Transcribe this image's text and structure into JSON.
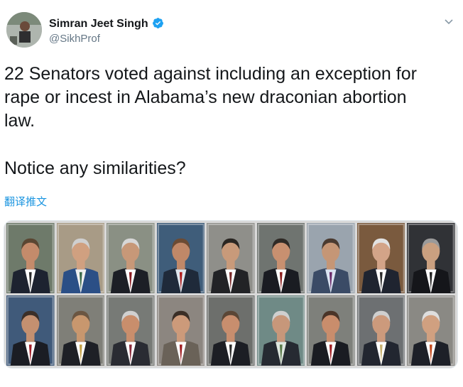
{
  "tweet": {
    "author_name": "Simran Jeet Singh",
    "author_handle": "@SikhProf",
    "text_line1": "22 Senators voted against including an exception for",
    "text_line2": "rape or incest in Alabama’s new draconian abortion",
    "text_line3": "law.",
    "text_question": "Notice any similarities?",
    "translate_label": "翻译推文"
  },
  "icons": {
    "verified": "verified-badge-icon",
    "menu": "chevron-down-icon"
  },
  "colors": {
    "text": "#14171a",
    "handle": "#657786",
    "link": "#1b95e0",
    "verified": "#1da1f2"
  },
  "media": {
    "rows": 2,
    "cols": 9,
    "photos": [
      {
        "bg": "#6e7a6a",
        "skin": "#c48b6b",
        "hair": "#5a4632",
        "suit": "#1d2330",
        "shirt": "#ffffff",
        "tie": "#2b2b2b"
      },
      {
        "bg": "#a89b86",
        "skin": "#d0a080",
        "hair": "#cfcfcf",
        "suit": "#2b4f86",
        "shirt": "#f0f0f0",
        "tie": "#3a6a4a"
      },
      {
        "bg": "#8a9084",
        "skin": "#c79878",
        "hair": "#d7d7d7",
        "suit": "#1c1f26",
        "shirt": "#ffffff",
        "tie": "#8a1c22"
      },
      {
        "bg": "#3f5d7a",
        "skin": "#c08868",
        "hair": "#6b4b34",
        "suit": "#1f2a3a",
        "shirt": "#dfe6ee",
        "tie": "#b01c1c"
      },
      {
        "bg": "#8f8f8a",
        "skin": "#c89a7a",
        "hair": "#2a2622",
        "suit": "#222326",
        "shirt": "#ffffff",
        "tie": "#7a2a2a"
      },
      {
        "bg": "#6f7470",
        "skin": "#c89070",
        "hair": "#2f2a26",
        "suit": "#1a1c22",
        "shirt": "#ffffff",
        "tie": "#8b1e1e"
      },
      {
        "bg": "#9aa4ae",
        "skin": "#c59676",
        "hair": "#4a3a30",
        "suit": "#3b4b66",
        "shirt": "#dbe4f2",
        "tie": "#6b2a6a"
      },
      {
        "bg": "#7a5a3e",
        "skin": "#d3a488",
        "hair": "#e2e2e2",
        "suit": "#1f2430",
        "shirt": "#ffffff",
        "tie": "#2a2a2a"
      },
      {
        "bg": "#303236",
        "skin": "#caa080",
        "hair": "#9a9a9a",
        "suit": "#15161a",
        "shirt": "#ffffff",
        "tie": "#202020"
      },
      {
        "bg": "#405a7a",
        "skin": "#c49070",
        "hair": "#3b2f28",
        "suit": "#1b1d24",
        "shirt": "#ffffff",
        "tie": "#a01e28"
      },
      {
        "bg": "#7f7f78",
        "skin": "#c8976e",
        "hair": "#6b5642",
        "suit": "#1e2026",
        "shirt": "#ffffff",
        "tie": "#c4a046"
      },
      {
        "bg": "#777a76",
        "skin": "#c98e6c",
        "hair": "#d0d0d0",
        "suit": "#2a2c33",
        "shirt": "#ffffff",
        "tie": "#8a2a3a"
      },
      {
        "bg": "#8c8680",
        "skin": "#cc9a7a",
        "hair": "#3a2e26",
        "suit": "#6a6258",
        "shirt": "#ffffff",
        "tie": "#a01e22"
      },
      {
        "bg": "#6d6f6c",
        "skin": "#c88e6e",
        "hair": "#5a4636",
        "suit": "#1c1e24",
        "shirt": "#ffffff",
        "tie": "#2a2a2a"
      },
      {
        "bg": "#6f8a86",
        "skin": "#c7977a",
        "hair": "#cfcfcf",
        "suit": "#262a32",
        "shirt": "#dfe7e0",
        "tie": "#5a7a4a"
      },
      {
        "bg": "#7e807b",
        "skin": "#c98d6c",
        "hair": "#4a3428",
        "suit": "#1a1c22",
        "shirt": "#ffffff",
        "tie": "#a01e22"
      },
      {
        "bg": "#6d7072",
        "skin": "#cc9a7c",
        "hair": "#cfcfcf",
        "suit": "#222630",
        "shirt": "#ffffff",
        "tie": "#c8b070"
      },
      {
        "bg": "#8a8984",
        "skin": "#d0a080",
        "hair": "#dedede",
        "suit": "#1d2028",
        "shirt": "#ffffff",
        "tie": "#c44a1e"
      }
    ]
  }
}
